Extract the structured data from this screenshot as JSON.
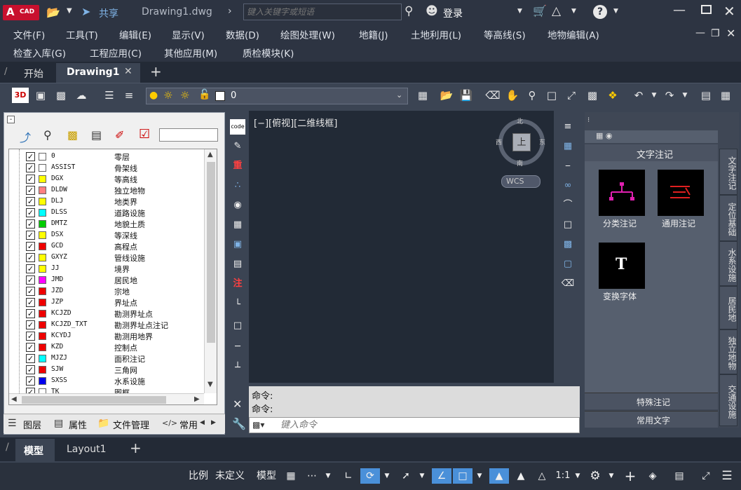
{
  "titlebar": {
    "logo_main": "A",
    "logo_sub": "CAD",
    "share_label": "共享",
    "doc_title": "Drawing1.dwg",
    "search_placeholder": "键入关键字或短语",
    "login_label": "登录"
  },
  "menu_row1": [
    "文件(F)",
    "工具(T)",
    "编辑(E)",
    "显示(V)",
    "数据(D)",
    "绘图处理(W)",
    "地籍(J)",
    "土地利用(L)",
    "等高线(S)",
    "地物编辑(A)"
  ],
  "menu_row2": [
    "检查入库(G)",
    "工程应用(C)",
    "其他应用(M)",
    "质检模块(K)"
  ],
  "doc_tabs": {
    "start": "开始",
    "active": "Drawing1"
  },
  "toolbar": {
    "three_d": "3D",
    "layer_value": "0"
  },
  "layers": [
    {
      "code": "0",
      "name": "零层",
      "color": "#ffffff"
    },
    {
      "code": "ASSIST",
      "name": "骨架线",
      "color": "#ffffff"
    },
    {
      "code": "DGX",
      "name": "等高线",
      "color": "#ffff00"
    },
    {
      "code": "DLDW",
      "name": "独立地物",
      "color": "#ff8080"
    },
    {
      "code": "DLJ",
      "name": "地类界",
      "color": "#ffff00"
    },
    {
      "code": "DLSS",
      "name": "道路设施",
      "color": "#00ffff"
    },
    {
      "code": "DMTZ",
      "name": "地貌土质",
      "color": "#00cc00"
    },
    {
      "code": "DSX",
      "name": "等深线",
      "color": "#ffff00"
    },
    {
      "code": "GCD",
      "name": "高程点",
      "color": "#ee0000"
    },
    {
      "code": "GXYZ",
      "name": "管线设施",
      "color": "#ffff00"
    },
    {
      "code": "JJ",
      "name": "境界",
      "color": "#ffff00"
    },
    {
      "code": "JMD",
      "name": "居民地",
      "color": "#ff00ff"
    },
    {
      "code": "JZD",
      "name": "宗地",
      "color": "#ee0000"
    },
    {
      "code": "JZP",
      "name": "界址点",
      "color": "#ee0000"
    },
    {
      "code": "KCJZD",
      "name": "勘测界址点",
      "color": "#ee0000"
    },
    {
      "code": "KCJZD_TXT",
      "name": "勘测界址点注记",
      "color": "#ee0000"
    },
    {
      "code": "KCYDJ",
      "name": "勘测用地界",
      "color": "#ee0000"
    },
    {
      "code": "KZD",
      "name": "控制点",
      "color": "#ee0000"
    },
    {
      "code": "MJZJ",
      "name": "面积注记",
      "color": "#00ffff"
    },
    {
      "code": "SJW",
      "name": "三角网",
      "color": "#ee0000"
    },
    {
      "code": "SXSS",
      "name": "水系设施",
      "color": "#0000ee"
    },
    {
      "code": "TK",
      "name": "图框",
      "color": "#ffffff"
    }
  ],
  "left_bottom_tabs": [
    "图层",
    "属性",
    "文件管理",
    "常用"
  ],
  "canvas": {
    "view_label": "[−][俯视][二维线框]"
  },
  "viewcube": {
    "north": "北",
    "south": "南",
    "east": "东",
    "west": "西",
    "top": "上",
    "wcs": "WCS"
  },
  "command": {
    "line1": "命令:",
    "line2": "命令:",
    "input_placeholder": "键入命令"
  },
  "right_panel": {
    "header": "文字注记",
    "items": [
      {
        "label": "分类注记",
        "icon": "tree-icon"
      },
      {
        "label": "通用注记",
        "icon": "lines-icon"
      },
      {
        "label": "变换字体",
        "icon": "font-icon",
        "glyph": "T"
      }
    ],
    "footer1": "特殊注记",
    "footer2": "常用文字"
  },
  "side_tabs": [
    "文字注记",
    "定位基础",
    "水系设施",
    "居民地",
    "独立地物",
    "交通设施"
  ],
  "layout_tabs": {
    "model": "模型",
    "layout1": "Layout1"
  },
  "statusbar": {
    "scale_label": "比例",
    "scale_value": "未定义",
    "model": "模型",
    "ratio": "1:1"
  },
  "colors": {
    "accent": "#4a90d9",
    "title_bg": "#2d3442",
    "canvas_bg": "#222a36",
    "red_logo": "#c8102e"
  }
}
